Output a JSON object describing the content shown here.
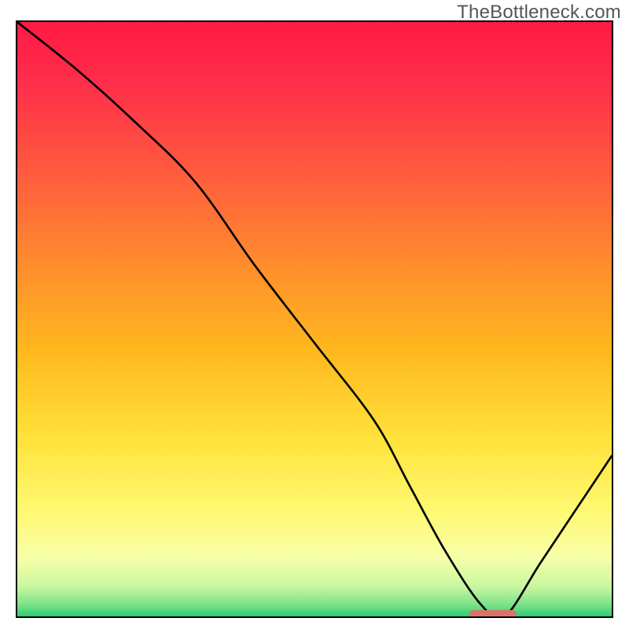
{
  "watermark": "TheBottleneck.com",
  "chart_data": {
    "type": "line",
    "title": "",
    "xlabel": "",
    "ylabel": "",
    "x_range": [
      0,
      100
    ],
    "y_range": [
      0,
      100
    ],
    "series": [
      {
        "name": "bottleneck-curve",
        "x": [
          0,
          10,
          20,
          30,
          40,
          50,
          60,
          66,
          72,
          78,
          82,
          88,
          94,
          100
        ],
        "y": [
          100,
          92,
          83,
          73,
          59,
          46,
          33,
          22,
          11,
          2,
          0,
          9,
          18,
          27
        ]
      }
    ],
    "optimal_marker": {
      "x_start": 76,
      "x_end": 84,
      "y": 0,
      "color": "#d9736a"
    },
    "background_gradient_stops": [
      {
        "offset": 0.0,
        "color": "#ff1a44"
      },
      {
        "offset": 0.1,
        "color": "#ff2d4a"
      },
      {
        "offset": 0.25,
        "color": "#ff5a3e"
      },
      {
        "offset": 0.4,
        "color": "#ff8a2e"
      },
      {
        "offset": 0.55,
        "color": "#ffb71e"
      },
      {
        "offset": 0.7,
        "color": "#ffe23a"
      },
      {
        "offset": 0.82,
        "color": "#fff870"
      },
      {
        "offset": 0.9,
        "color": "#f8ffa8"
      },
      {
        "offset": 0.95,
        "color": "#c8f7a0"
      },
      {
        "offset": 0.98,
        "color": "#7de28a"
      },
      {
        "offset": 1.0,
        "color": "#2ecc71"
      }
    ]
  }
}
